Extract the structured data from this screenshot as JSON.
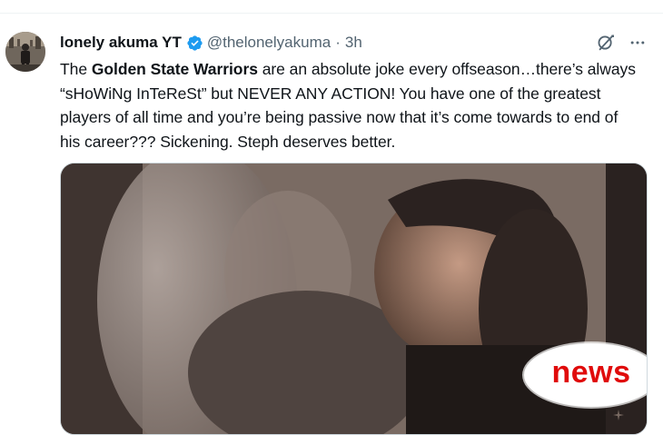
{
  "tweet": {
    "display_name": "lonely akuma YT",
    "handle": "@thelonelyakuma",
    "separator": "·",
    "time": "3h",
    "text_prefix": "The ",
    "text_bold": "Golden State Warriors",
    "text_suffix": " are an absolute joke every offseason…there’s always “sHoWiNg InTeReSt” but NEVER ANY ACTION! You have one of the greatest players of all time and you’re being passive now that it’s come towards to end of his career??? Sickening. Steph deserves better.",
    "media": {
      "badge_text": "news"
    }
  },
  "icons": {
    "verified": "verified-badge-icon",
    "grok": "grok-icon",
    "more": "more-icon"
  },
  "colors": {
    "verified_blue": "#1d9bf0",
    "text_primary": "#0f1419",
    "text_secondary": "#536471",
    "badge_red": "#e00b0b"
  }
}
